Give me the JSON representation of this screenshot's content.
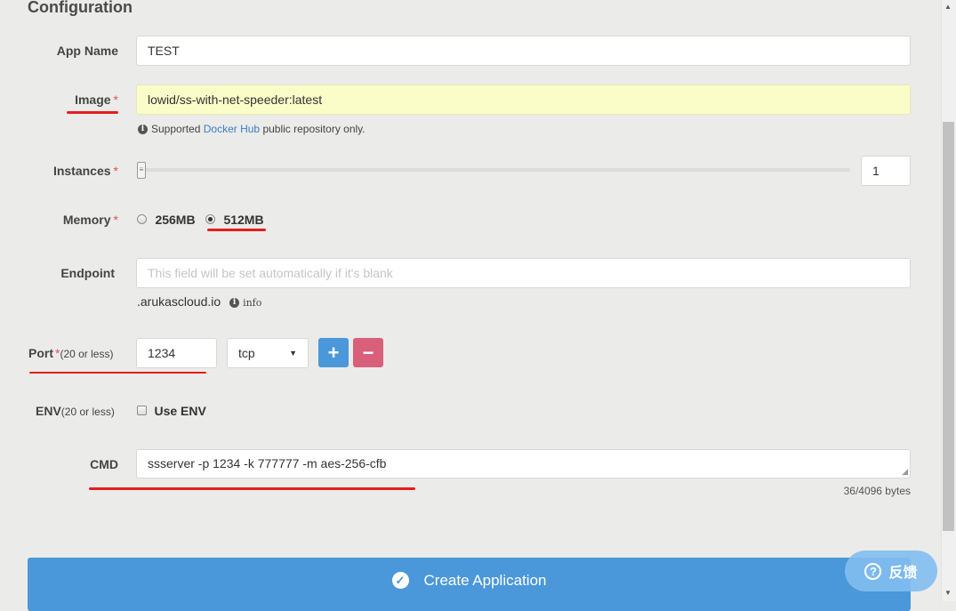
{
  "section_title": "Configuration",
  "app_name": {
    "label": "App Name",
    "value": "TEST"
  },
  "image": {
    "label": "Image",
    "required": "*",
    "value": "lowid/ss-with-net-speeder:latest",
    "help_prefix": "Supported",
    "help_link": "Docker Hub",
    "help_suffix": "public repository only."
  },
  "instances": {
    "label": "Instances",
    "required": "*",
    "value": "1",
    "level": 1
  },
  "memory": {
    "label": "Memory",
    "required": "*",
    "options": [
      {
        "label": "256MB",
        "checked": false
      },
      {
        "label": "512MB",
        "checked": true
      }
    ]
  },
  "endpoint": {
    "label": "Endpoint",
    "placeholder": "This field will be set automatically if it's blank",
    "suffix": ".arukascloud.io",
    "info_label": "info"
  },
  "port": {
    "label": "Port",
    "required": "*",
    "hint": "(20 or less)",
    "value": "1234",
    "protocol": "tcp",
    "add_label": "+",
    "remove_label": "−"
  },
  "env": {
    "label": "ENV",
    "hint": "(20 or less)",
    "checkbox_label": "Use ENV",
    "checked": false
  },
  "cmd": {
    "label": "CMD",
    "value": "ssserver -p 1234 -k 777777 -m aes-256-cfb",
    "byte_count": "36/4096 bytes"
  },
  "create_button": {
    "label": "Create Application"
  },
  "feedback_button": {
    "label": "反馈"
  },
  "colors": {
    "primary": "#4a97d9",
    "danger": "#d9607a",
    "highlight": "#fafdc8",
    "annotation": "#e51d1d"
  }
}
